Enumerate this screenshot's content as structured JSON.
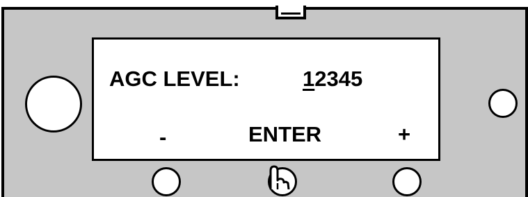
{
  "display": {
    "label": "AGC LEVEL:",
    "value_cursor_digit": "1",
    "value_rest": "2345",
    "softkeys": {
      "minus": "-",
      "enter": "ENTER",
      "plus": "+"
    }
  },
  "icons": {
    "pointer": "pointing-hand-icon"
  },
  "colors": {
    "panel": "#c6c6c6",
    "screen": "#ffffff",
    "outline": "#000000"
  }
}
